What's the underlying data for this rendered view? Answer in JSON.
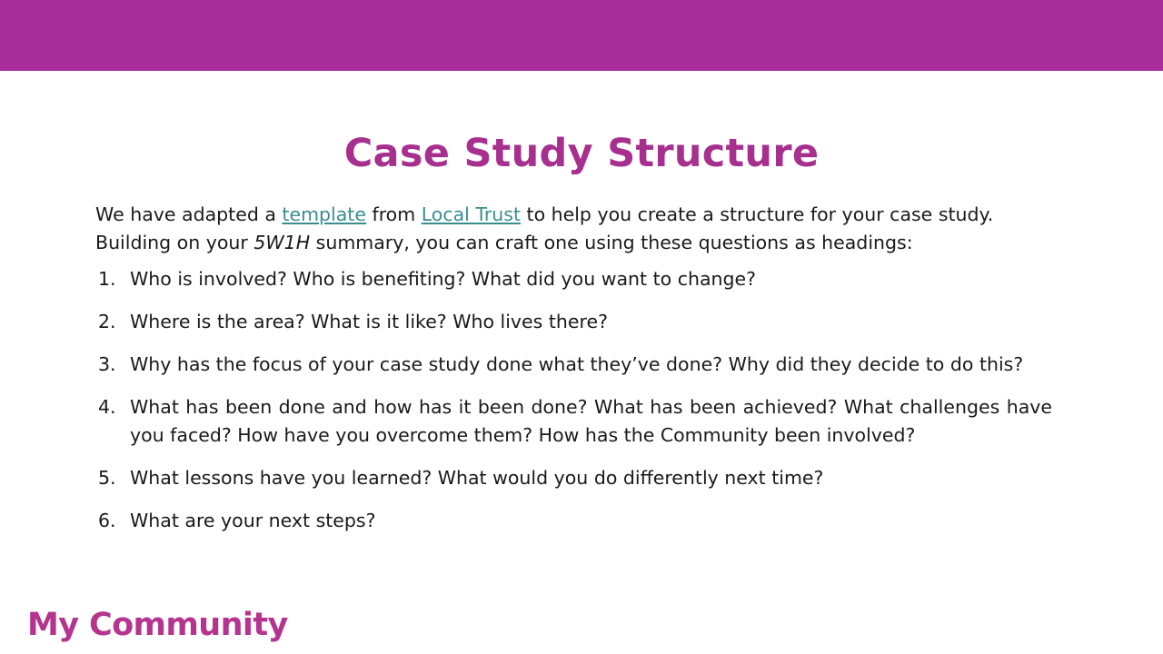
{
  "slide": {
    "title": "Case Study Structure",
    "top_bar_color": "#a82e9c",
    "title_color": "#a7308f",
    "link_color": "#3a8e90",
    "body_text_color": "#1a1a1a",
    "background_color": "#ffffff"
  },
  "intro": {
    "part1": "We have adapted a ",
    "link_template": "template",
    "part2": " from ",
    "link_local_trust": "Local Trust",
    "part3": " to help you create a structure for your case study. Building on your ",
    "italic_term": "5W1H",
    "part4": " summary, you can craft one using these questions as headings:"
  },
  "questions": [
    {
      "number": "1.",
      "text": "Who is involved? Who is benefiting? What did you want to change?",
      "justified": false
    },
    {
      "number": "2.",
      "text": "Where is the area? What is it like? Who lives there?",
      "justified": false
    },
    {
      "number": "3.",
      "text": "Why has the focus of your case study done what they’ve done? Why did they decide to do this?",
      "justified": true
    },
    {
      "number": "4.",
      "text": "What has been done and how has it been done? What has been achieved? What challenges have you faced? How have you overcome them? How has the Community been involved?",
      "justified": true
    },
    {
      "number": "5.",
      "text": "What lessons have you learned? What would you do differently next time?",
      "justified": false
    },
    {
      "number": "6.",
      "text": "What are your next steps?",
      "justified": false
    }
  ],
  "footer": {
    "logo_text": "My Community",
    "logo_color": "#b5348f"
  }
}
